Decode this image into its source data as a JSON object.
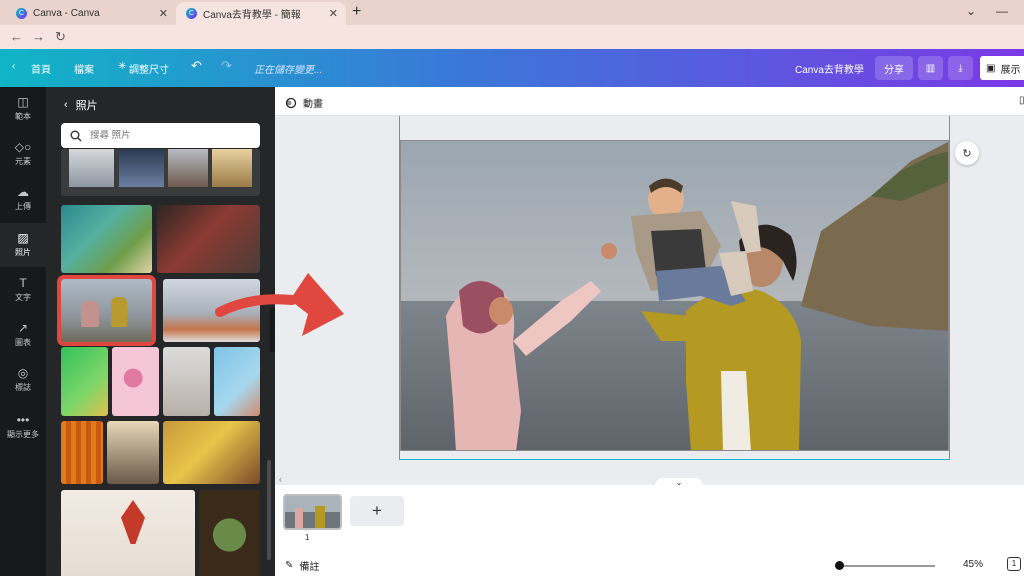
{
  "browser": {
    "tabs": [
      {
        "title": "Canva - Canva"
      },
      {
        "title": "Canva去背教學 - 簡報"
      }
    ],
    "new_tab": "+",
    "tab_close": "✕"
  },
  "header": {
    "home": "首頁",
    "file": "檔案",
    "resize": "調整尺寸",
    "saving": "正在儲存變更...",
    "doc_title": "Canva去背教學",
    "share": "分享",
    "present": "展示"
  },
  "rail": [
    {
      "label": "範本",
      "icon": "template-icon"
    },
    {
      "label": "元素",
      "icon": "elements-icon"
    },
    {
      "label": "上傳",
      "icon": "upload-icon"
    },
    {
      "label": "照片",
      "icon": "photo-icon"
    },
    {
      "label": "文字",
      "icon": "text-icon"
    },
    {
      "label": "圖表",
      "icon": "chart-icon"
    },
    {
      "label": "標誌",
      "icon": "logo-icon"
    },
    {
      "label": "顯示更多",
      "icon": "more-icon"
    }
  ],
  "panel": {
    "title": "照片",
    "search_placeholder": "搜尋 照片"
  },
  "editor": {
    "animate": "動畫",
    "page_number": "1",
    "add_page": "+",
    "notes": "備註",
    "zoom": "45%",
    "page_count": "1",
    "zoom_level": 0.04
  },
  "colors": {
    "accent": "#19b7cb",
    "purple": "#7b3ae6",
    "highlight": "#e0473e"
  }
}
